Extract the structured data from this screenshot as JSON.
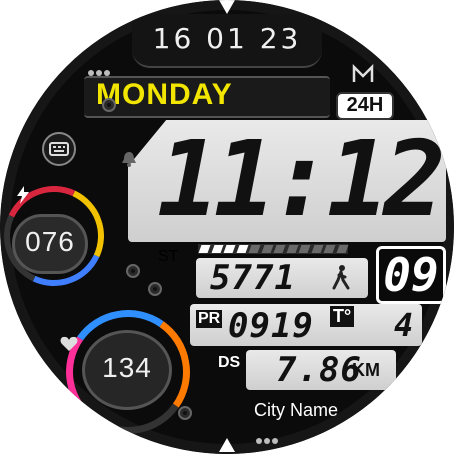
{
  "date": "16 01 23",
  "weekday": "MONDAY",
  "format_badge": "24H",
  "time": "11:12",
  "seconds": "09",
  "steps": {
    "label": "ST",
    "value": "5771",
    "progress_segments_filled": 4,
    "progress_segments_total": 12
  },
  "pressure": {
    "label": "PR",
    "value": "0919"
  },
  "temperature": {
    "label": "T°",
    "value": "4"
  },
  "distance": {
    "label": "DS",
    "value": "7.86",
    "unit": "KM"
  },
  "battery": {
    "value": "076"
  },
  "heart_rate": {
    "value": "134"
  },
  "city": "City Name",
  "colors": {
    "accent_yellow": "#f2e600",
    "lcd": "#dcdcdc",
    "bezel": "#0b0b0b",
    "panel": "#1c1c1c"
  },
  "icons": {
    "battery": "lightning-icon",
    "heart": "heart-icon",
    "alarm": "bell-icon",
    "walker": "walking-person-icon",
    "keyboard": "keyboard-icon",
    "brand": "m-logo-icon"
  }
}
